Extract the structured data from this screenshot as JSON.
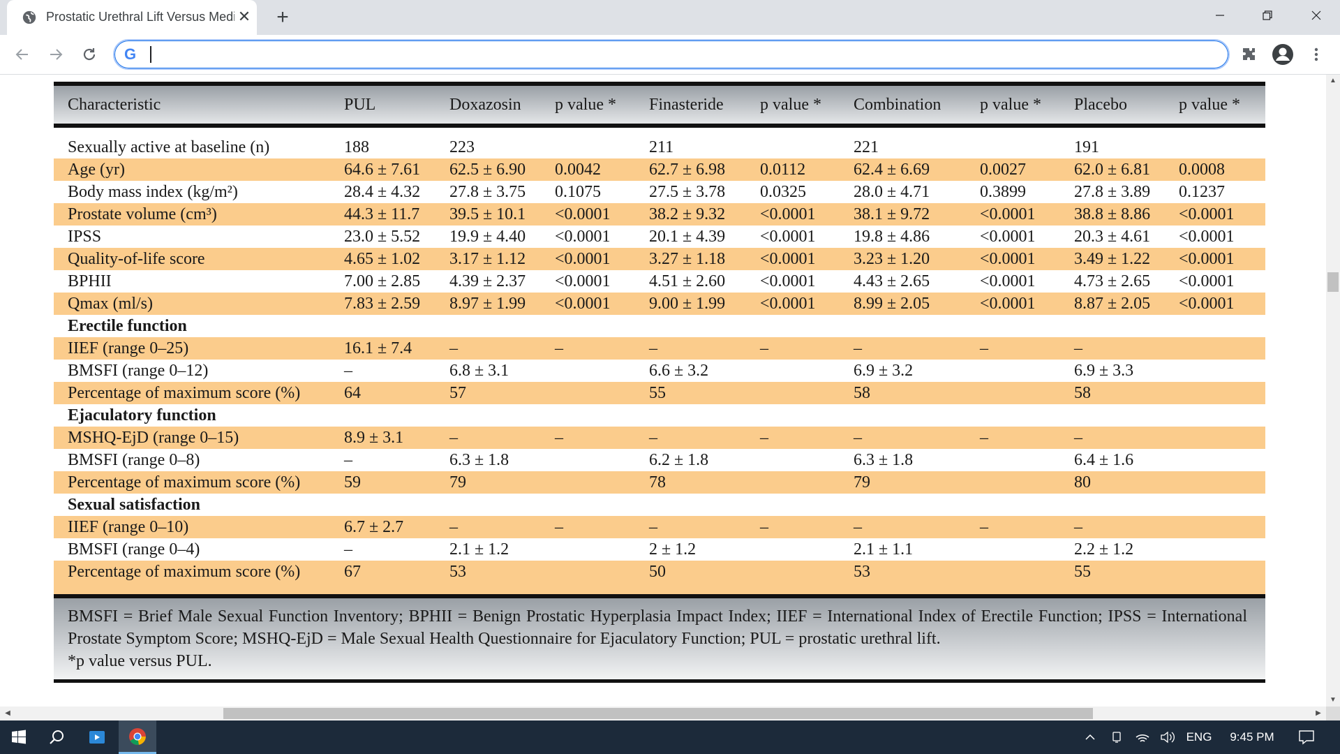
{
  "browser": {
    "tab_title": "Prostatic Urethral Lift Versus Medical Therapy: Examining the Impact",
    "close_glyph": "✕",
    "newtab_glyph": "+",
    "omnibox_badge": "G",
    "omnibox_value": "",
    "omnibox_placeholder": ""
  },
  "table": {
    "headers": [
      "Characteristic",
      "PUL",
      "Doxazosin",
      "p value *",
      "Finasteride",
      "p value *",
      "Combination",
      "p value *",
      "Placebo",
      "p value *"
    ],
    "rows": [
      {
        "style": "plain",
        "cells": [
          "Sexually active at baseline (n)",
          "188",
          "223",
          "",
          "211",
          "",
          "221",
          "",
          "191",
          ""
        ]
      },
      {
        "style": "alt",
        "cells": [
          "Age (yr)",
          "64.6 ± 7.61",
          "62.5 ± 6.90",
          "0.0042",
          "62.7 ± 6.98",
          "0.0112",
          "62.4 ± 6.69",
          "0.0027",
          "62.0 ± 6.81",
          "0.0008"
        ]
      },
      {
        "style": "plain",
        "cells": [
          "Body mass index (kg/m²)",
          "28.4 ± 4.32",
          "27.8 ± 3.75",
          "0.1075",
          "27.5 ± 3.78",
          "0.0325",
          "28.0 ± 4.71",
          "0.3899",
          "27.8 ± 3.89",
          "0.1237"
        ]
      },
      {
        "style": "alt",
        "cells": [
          "Prostate volume (cm³)",
          "44.3 ± 11.7",
          "39.5 ± 10.1",
          "<0.0001",
          "38.2 ± 9.32",
          "<0.0001",
          "38.1 ± 9.72",
          "<0.0001",
          "38.8 ± 8.86",
          "<0.0001"
        ]
      },
      {
        "style": "plain",
        "cells": [
          "IPSS",
          "23.0 ± 5.52",
          "19.9 ± 4.40",
          "<0.0001",
          "20.1 ± 4.39",
          "<0.0001",
          "19.8 ± 4.86",
          "<0.0001",
          "20.3 ± 4.61",
          "<0.0001"
        ]
      },
      {
        "style": "alt",
        "cells": [
          "Quality-of-life score",
          "4.65 ± 1.02",
          "3.17 ± 1.12",
          "<0.0001",
          "3.27 ± 1.18",
          "<0.0001",
          "3.23 ± 1.20",
          "<0.0001",
          "3.49 ± 1.22",
          "<0.0001"
        ]
      },
      {
        "style": "plain",
        "cells": [
          "BPHII",
          "7.00 ± 2.85",
          "4.39 ± 2.37",
          "<0.0001",
          "4.51 ± 2.60",
          "<0.0001",
          "4.43 ± 2.65",
          "<0.0001",
          "4.73 ± 2.65",
          "<0.0001"
        ]
      },
      {
        "style": "alt",
        "cells": [
          "Qmax (ml/s)",
          "7.83 ± 2.59",
          "8.97 ± 1.99",
          "<0.0001",
          "9.00 ± 1.99",
          "<0.0001",
          "8.99 ± 2.05",
          "<0.0001",
          "8.87 ± 2.05",
          "<0.0001"
        ]
      },
      {
        "style": "sect",
        "cells": [
          "Erectile function",
          "",
          "",
          "",
          "",
          "",
          "",
          "",
          "",
          ""
        ]
      },
      {
        "style": "alt",
        "cells": [
          "IIEF (range 0–25)",
          "16.1 ± 7.4",
          "–",
          "–",
          "–",
          "–",
          "–",
          "–",
          "–",
          ""
        ]
      },
      {
        "style": "plain",
        "cells": [
          "BMSFI (range 0–12)",
          "–",
          "6.8 ± 3.1",
          "",
          "6.6 ± 3.2",
          "",
          "6.9 ± 3.2",
          "",
          "6.9 ± 3.3",
          ""
        ]
      },
      {
        "style": "alt",
        "cells": [
          "Percentage of maximum score (%)",
          "64",
          "57",
          "",
          "55",
          "",
          "58",
          "",
          "58",
          ""
        ]
      },
      {
        "style": "sect",
        "cells": [
          "Ejaculatory function",
          "",
          "",
          "",
          "",
          "",
          "",
          "",
          "",
          ""
        ]
      },
      {
        "style": "alt",
        "cells": [
          "MSHQ-EjD (range 0–15)",
          "8.9 ± 3.1",
          "–",
          "–",
          "–",
          "–",
          "–",
          "–",
          "–",
          ""
        ]
      },
      {
        "style": "plain",
        "cells": [
          "BMSFI (range 0–8)",
          "–",
          "6.3 ± 1.8",
          "",
          "6.2 ± 1.8",
          "",
          "6.3 ± 1.8",
          "",
          "6.4 ± 1.6",
          ""
        ]
      },
      {
        "style": "alt",
        "cells": [
          "Percentage of maximum score (%)",
          "59",
          "79",
          "",
          "78",
          "",
          "79",
          "",
          "80",
          ""
        ]
      },
      {
        "style": "sect",
        "cells": [
          "Sexual satisfaction",
          "",
          "",
          "",
          "",
          "",
          "",
          "",
          "",
          ""
        ]
      },
      {
        "style": "alt",
        "cells": [
          "IIEF (range 0–10)",
          "6.7 ± 2.7",
          "–",
          "–",
          "–",
          "–",
          "–",
          "–",
          "–",
          ""
        ]
      },
      {
        "style": "plain",
        "cells": [
          "BMSFI (range 0–4)",
          "–",
          "2.1 ± 1.2",
          "",
          "2 ± 1.2",
          "",
          "2.1 ± 1.1",
          "",
          "2.2 ± 1.2",
          ""
        ]
      },
      {
        "style": "alt",
        "cells": [
          "Percentage of maximum score (%)",
          "67",
          "53",
          "",
          "50",
          "",
          "53",
          "",
          "55",
          ""
        ]
      }
    ],
    "footnote_abbrev": "BMSFI = Brief Male Sexual Function Inventory; BPHII = Benign Prostatic Hyperplasia Impact Index; IIEF = International Index of Erectile Function; IPSS = International Prostate Symptom Score; MSHQ-EjD = Male Sexual Health Questionnaire for Ejaculatory Function; PUL = prostatic urethral lift.",
    "footnote_p": "*p value versus PUL."
  },
  "taskbar": {
    "language": "ENG",
    "time": "9:45 PM"
  },
  "colors": {
    "row_highlight": "#fbcc8c",
    "header_gradient_top": "#9aa0a6",
    "rule": "#111111",
    "taskbar": "#1c2a3a"
  },
  "icons": [
    "globe-icon",
    "close-icon",
    "plus-icon",
    "minimize-icon",
    "restore-icon",
    "window-close-icon",
    "back-arrow-icon",
    "forward-arrow-icon",
    "reload-icon",
    "google-icon",
    "extensions-puzzle-icon",
    "profile-icon",
    "kebab-menu-icon",
    "windows-start-icon",
    "search-icon",
    "app-icon",
    "chrome-icon",
    "chevron-up-icon",
    "network-icon",
    "wifi-icon",
    "volume-icon",
    "notification-icon"
  ]
}
